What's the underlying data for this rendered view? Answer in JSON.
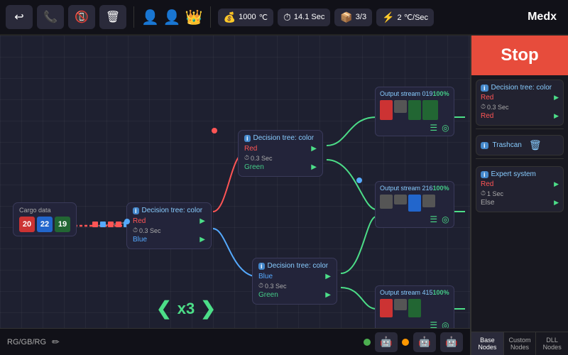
{
  "topbar": {
    "back_icon": "←",
    "phone_icon": "📞",
    "phone_down_icon": "📵",
    "trash_icon": "🗑",
    "avatar1": "👤",
    "avatar2": "👤",
    "avatar3": "👤",
    "coins": "1000",
    "coin_icon": "💰",
    "time_icon": "⏱",
    "time_val": "14.1 Sec",
    "box_icon": "📦",
    "fraction": "3/3",
    "rate_icon": "⚡",
    "rate_val": "2 ℃/Sec",
    "username": "Medx"
  },
  "bottombar": {
    "label": "RG/GB/RG",
    "edit_icon": "✏"
  },
  "x3": {
    "label": "x3"
  },
  "canvas": {
    "cargo_node": {
      "title": "Cargo data",
      "items": [
        {
          "label": "20",
          "color": "red"
        },
        {
          "label": "22",
          "color": "blue"
        },
        {
          "label": "19",
          "color": "green"
        }
      ]
    },
    "decision1": {
      "title": "Decision tree: color",
      "row1_label": "Red",
      "row2_label": "Green",
      "time": "0.3 Sec"
    },
    "decision2": {
      "title": "Decision tree: color",
      "row1_label": "Red",
      "row2_label": "Blue",
      "time": "0.3 Sec"
    },
    "decision3": {
      "title": "Decision tree: color",
      "row1_label": "Blue",
      "row2_label": "Green",
      "time": "0.3 Sec"
    },
    "output0": {
      "title": "Output stream 0",
      "count": "19",
      "pct": "100%"
    },
    "output2": {
      "title": "Output stream 2",
      "count": "16",
      "pct": "100%"
    },
    "output4": {
      "title": "Output stream 4",
      "count": "15",
      "pct": "100%"
    }
  },
  "right_panel": {
    "stop_label": "Stop",
    "node1": {
      "title": "Decision tree: color",
      "row1": "Red",
      "row2": "Red",
      "time": "0.3 Sec"
    },
    "trashcan": {
      "title": "Trashcan"
    },
    "expert": {
      "title": "Expert system",
      "row1": "Red",
      "row2": "Else",
      "time": "1 Sec"
    },
    "tabs": [
      {
        "label": "Base\nNodes",
        "active": true
      },
      {
        "label": "Custom\nNodes",
        "active": false
      },
      {
        "label": "DLL\nNodes",
        "active": false
      }
    ]
  }
}
